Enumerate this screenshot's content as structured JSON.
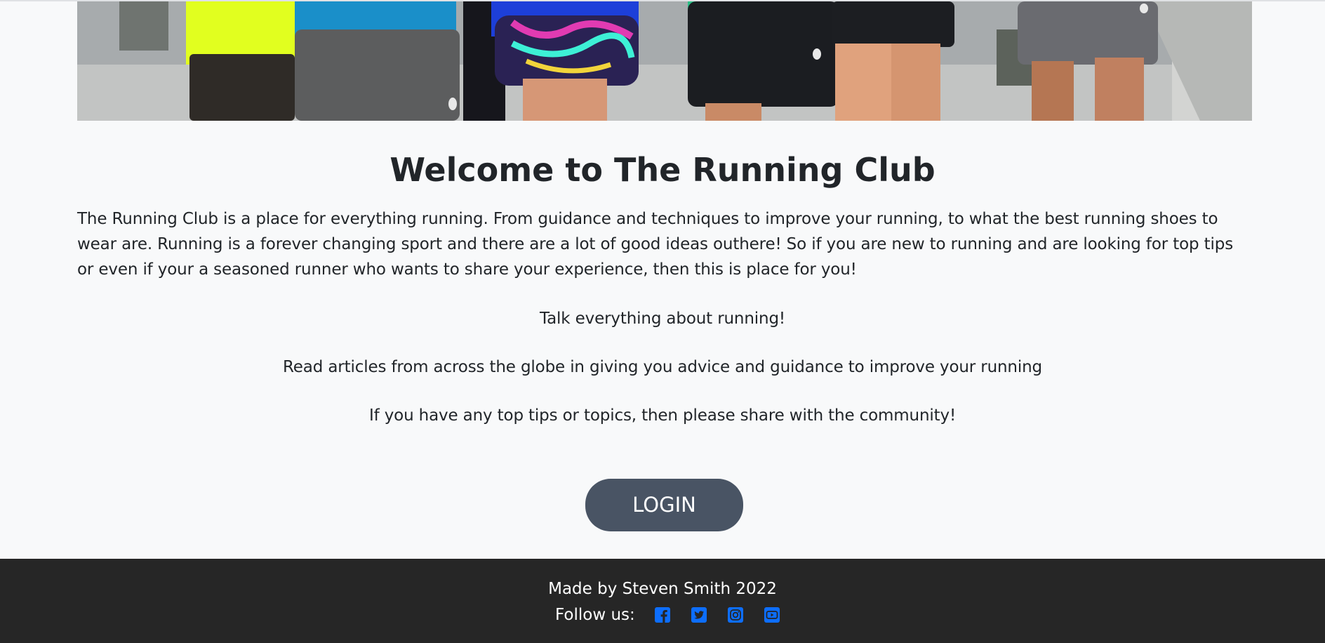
{
  "hero": {
    "shoe_logo_color": "#e8e8e8"
  },
  "main": {
    "title": "Welcome to The Running Club",
    "intro": "The Running Club is a place for everything running. From guidance and techniques to improve your running, to what the best running shoes to wear are. Running is a forever changing sport and there are a lot of good ideas outhere! So if you are new to running and are looking for top tips or even if your a seasoned runner who wants to share your experience, then this is place for you!",
    "line1": "Talk everything about running!",
    "line2": "Read articles from across the globe in giving you advice and guidance to improve your running",
    "line3": "If you have any top tips or topics, then please share with the community!",
    "login_label": "LOGIN"
  },
  "footer": {
    "made_by": "Made by Steven Smith 2022",
    "follow_label": "Follow us:",
    "social_icons": [
      "facebook-icon",
      "twitter-icon",
      "instagram-icon",
      "youtube-icon"
    ],
    "icon_color": "#0d6efd"
  },
  "colors": {
    "background": "#f8f9fa",
    "login_button": "#495464",
    "footer_background": "#262626"
  }
}
